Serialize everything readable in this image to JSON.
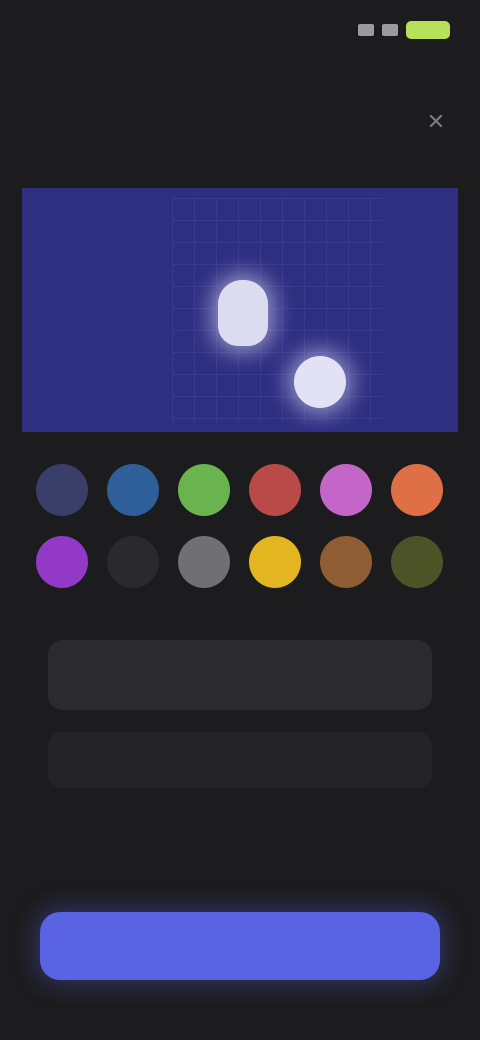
{
  "status_bar": {
    "time": "",
    "carrier": ""
  },
  "header": {
    "title": "",
    "close_icon": "close-icon"
  },
  "subtitle": "",
  "preview": {
    "background": "#2f2f82"
  },
  "swatches": [
    {
      "name": "slate",
      "color": "#3a3f6a"
    },
    {
      "name": "blue",
      "color": "#2f5f9a"
    },
    {
      "name": "green",
      "color": "#69b44f"
    },
    {
      "name": "red",
      "color": "#b94a48"
    },
    {
      "name": "pink",
      "color": "#c466c7"
    },
    {
      "name": "orange",
      "color": "#df6f45"
    },
    {
      "name": "purple",
      "color": "#9339c8"
    },
    {
      "name": "charcoal",
      "color": "#2a2a2e"
    },
    {
      "name": "gray",
      "color": "#707074"
    },
    {
      "name": "yellow",
      "color": "#e2b521"
    },
    {
      "name": "brown",
      "color": "#8f5d33"
    },
    {
      "name": "olive",
      "color": "#4c5427"
    }
  ],
  "info_card": {
    "text": ""
  },
  "secondary_button": {
    "label": ""
  },
  "primary_button": {
    "label": "",
    "color": "#5b63e5"
  }
}
